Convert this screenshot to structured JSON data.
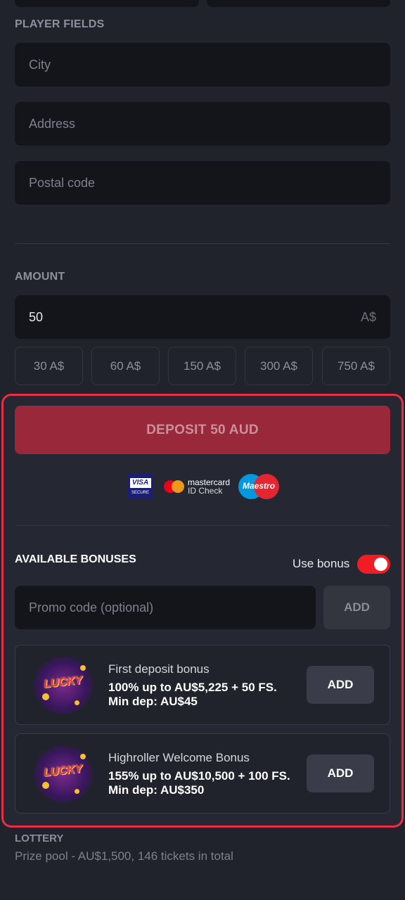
{
  "player_fields": {
    "title": "PLAYER FIELDS",
    "city_placeholder": "City",
    "address_placeholder": "Address",
    "postal_placeholder": "Postal code"
  },
  "amount": {
    "title": "AMOUNT",
    "value": "50",
    "currency": "A$",
    "presets": [
      "30 A$",
      "60 A$",
      "150 A$",
      "300 A$",
      "750 A$"
    ]
  },
  "deposit": {
    "button_label": "DEPOSIT 50 AUD",
    "visa_text": "VISA",
    "visa_secure": "SECURE",
    "mastercard_line1": "mastercard",
    "mastercard_line2": "ID Check",
    "maestro_text": "Maestro"
  },
  "bonuses": {
    "title": "AVAILABLE BONUSES",
    "use_bonus_label": "Use bonus",
    "use_bonus_on": true,
    "promo_placeholder": "Promo code (optional)",
    "promo_add_label": "ADD",
    "items": [
      {
        "name": "First deposit bonus",
        "line1": "100% up to AU$5,225 + 50 FS.",
        "line2": "Min dep: AU$45",
        "add_label": "ADD",
        "image_text": "LUCKY"
      },
      {
        "name": "Highroller Welcome Bonus",
        "line1": "155% up to AU$10,500 + 100 FS.",
        "line2": "Min dep: AU$350",
        "add_label": "ADD",
        "image_text": "LUCKY"
      }
    ]
  },
  "lottery": {
    "title": "LOTTERY",
    "description": "Prize pool - AU$1,500, 146 tickets in total"
  },
  "colors": {
    "background": "#20222c",
    "field_bg": "#14151b",
    "accent_red": "#ea2d45",
    "deposit_btn": "#98283a",
    "toggle_on": "#f21c24"
  }
}
